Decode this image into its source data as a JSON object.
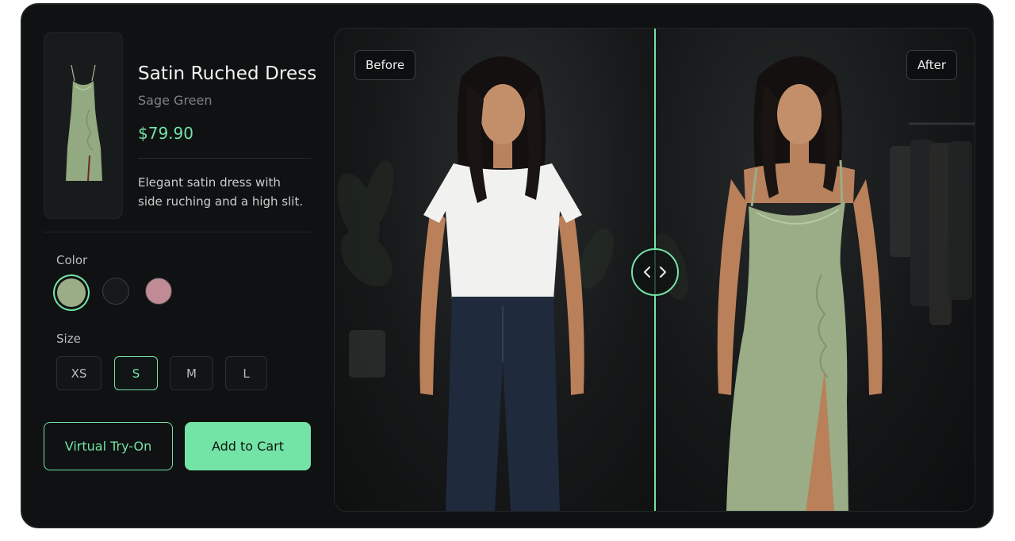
{
  "product": {
    "name": "Satin Ruched Dress",
    "variant": "Sage Green",
    "price": "$79.90",
    "description": "Elegant satin dress with side ruching and a high slit."
  },
  "color": {
    "label": "Color",
    "swatches": [
      {
        "name": "sage",
        "hex": "#9aad86",
        "selected": true
      },
      {
        "name": "black",
        "hex": "#15191a",
        "selected": false
      },
      {
        "name": "rose",
        "hex": "#c08b94",
        "selected": false
      }
    ]
  },
  "size": {
    "label": "Size",
    "options": [
      "XS",
      "S",
      "M",
      "L"
    ],
    "selected": "S"
  },
  "actions": {
    "try_on": "Virtual Try-On",
    "add_to_cart": "Add to Cart"
  },
  "compare": {
    "before_label": "Before",
    "after_label": "After",
    "handle_icon": "chevrons-left-right-icon"
  },
  "colors": {
    "accent": "#74e3a6",
    "background": "#0f1112",
    "dress": "#9aad86"
  }
}
